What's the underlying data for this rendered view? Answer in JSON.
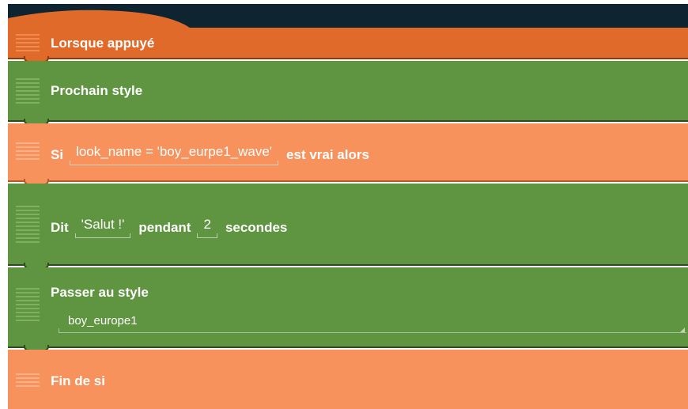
{
  "colors": {
    "topbar": "#0e2430",
    "event_brick": "#e06a2a",
    "look_brick": "#5f9440",
    "control_brick": "#f7925c"
  },
  "bricks": {
    "when_tapped": {
      "label": "Lorsque appuyé"
    },
    "next_look": {
      "label": "Prochain style"
    },
    "if": {
      "keyword": "Si",
      "condition": "look_name = 'boy_eurpe1_wave'",
      "suffix": "est vrai alors"
    },
    "say": {
      "keyword": "Dit",
      "text": "'Salut !'",
      "middle": "pendant",
      "seconds": "2",
      "unit": "secondes"
    },
    "switch_look": {
      "label": "Passer au style",
      "value": "boy_europe1"
    },
    "end_if": {
      "label": "Fin de si"
    }
  }
}
